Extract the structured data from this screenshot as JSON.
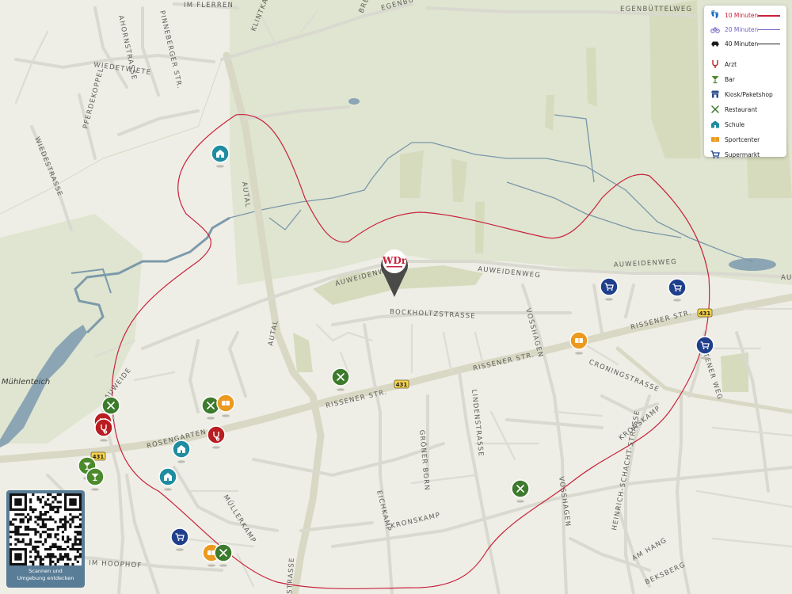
{
  "legend": {
    "isochrones": [
      {
        "label": "10 Minuten",
        "icon": "walking-icon",
        "color": "#c8233c"
      },
      {
        "label": "20 Minuten",
        "icon": "bicycle-icon",
        "color": "#6f65c2"
      },
      {
        "label": "40 Minuten",
        "icon": "car-icon",
        "color": "#1d1d1b"
      }
    ],
    "categories": [
      {
        "label": "Arzt",
        "icon": "stethoscope-icon",
        "color": "#b81d22"
      },
      {
        "label": "Bar",
        "icon": "cocktail-icon",
        "color": "#4b8a2c"
      },
      {
        "label": "Kiosk/Paketshop",
        "icon": "kiosk-icon",
        "color": "#2b4d8c"
      },
      {
        "label": "Restaurant",
        "icon": "cutlery-icon",
        "color": "#3d7a2d"
      },
      {
        "label": "Schule",
        "icon": "school-icon",
        "color": "#1f8ca0"
      },
      {
        "label": "Sportcenter",
        "icon": "ticket-icon",
        "color": "#eb9a1f"
      },
      {
        "label": "Supermarkt",
        "icon": "cart-icon",
        "color": "#1f3f8c"
      }
    ]
  },
  "brand": {
    "logo_text": "WDr",
    "accent": "#c8233c"
  },
  "places": {
    "muehlenteich": "Mühlenteich"
  },
  "streets": {
    "im_flerren": "IM FLERREN",
    "egenbuetteweg": "EGENBÜTTELWEG",
    "egenbu_top": "EGENBU",
    "ahornstrasse": "AHORNSTRASSE",
    "klintkamp": "KLINTKAMP",
    "bre": "BRE",
    "wiedetwiete": "WIEDETWIETE",
    "pinneberger": "PINNEBERGER STR.",
    "pferdekoppel": "PFERDEKOPPEL",
    "wiedestrasse": "WIEDESTRASSE",
    "autal": "AUTAL",
    "autal2": "AUTAL",
    "auweidenweg_left": "AUWEIDENWEG",
    "auweidenweg_mid": "AUWEIDENWEG",
    "auweidenweg_right": "AUWEIDENWEG",
    "au_edge": "AU",
    "bockholtzstrasse": "BOCKHOLTZSTRASSE",
    "vosshagen_top": "VOSSHAGEN",
    "vosshagen_bottom": "VOSSHAGEN",
    "rissener_right": "RISSENER STR.",
    "rissener_mid": "RISSENER STR.",
    "rissener_left": "RISSENER STR.",
    "croningstrasse": "CRONINGSTRASSE",
    "pistener_weg": "PISTENER WEG",
    "auweide": "AUWEIDE",
    "rosengarten": "ROSENGARTEN",
    "lindenstrasse": "LINDENSTRASSE",
    "groener_born": "GRÖNER BORN",
    "eichkamp": "EICHKAMP",
    "muellerkamp": "MÜLLERKAMP",
    "kronskamp_right": "KRONSKAMP",
    "kronskamp_bottom": "KRONSKAMP",
    "heinrich_schacht": "HEINRICH-SCHACHT-STRASSE",
    "am_hang": "AM HANG",
    "beksberg": "BEKSBERG",
    "im_hoophof": "IM HOOPHOF",
    "strasse_bottom": "STRASSE"
  },
  "shields": {
    "s1": "431",
    "s2": "431",
    "s3": "431"
  },
  "qr": {
    "caption_line1": "Scannen und",
    "caption_line2": "Umgebung entdecken"
  },
  "poi_markers": [
    {
      "category": "Schule"
    },
    {
      "category": "Restaurant"
    },
    {
      "category": "Restaurant"
    },
    {
      "category": "Arzt"
    },
    {
      "category": "Arzt"
    },
    {
      "category": "Bar"
    },
    {
      "category": "Bar"
    },
    {
      "category": "Restaurant"
    },
    {
      "category": "Sportcenter"
    },
    {
      "category": "Arzt"
    },
    {
      "category": "Schule"
    },
    {
      "category": "Schule"
    },
    {
      "category": "Supermarkt"
    },
    {
      "category": "Sportcenter"
    },
    {
      "category": "Restaurant"
    },
    {
      "category": "Restaurant"
    },
    {
      "category": "Sportcenter"
    },
    {
      "category": "Supermarkt"
    },
    {
      "category": "Supermarkt"
    },
    {
      "category": "Supermarkt"
    }
  ]
}
